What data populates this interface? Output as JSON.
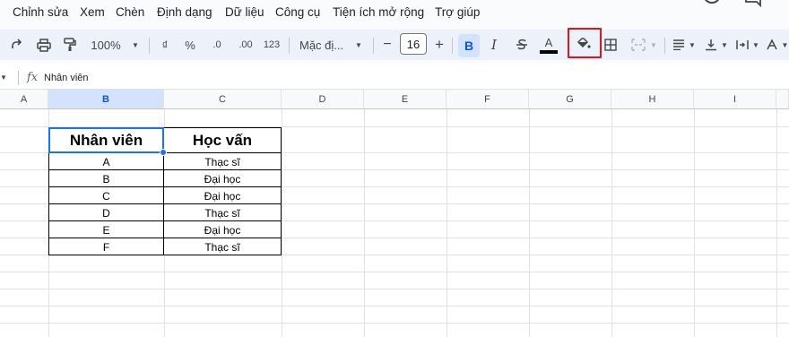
{
  "menu": {
    "items": [
      "Chỉnh sửa",
      "Xem",
      "Chèn",
      "Định dạng",
      "Dữ liệu",
      "Công cụ",
      "Tiện ích mở rộng",
      "Trợ giúp"
    ]
  },
  "toolbar": {
    "zoom": "100%",
    "currency_symbol": "₫",
    "percent_symbol": "%",
    "decrease_decimal": ".0",
    "increase_decimal": ".00",
    "more_formats": "123",
    "font_name": "Mặc đị...",
    "font_size": "16",
    "minus": "−",
    "plus": "+",
    "bold": "B",
    "italic": "I",
    "text_color_letter": "A",
    "highlighted_tool": "fill-color-icon"
  },
  "formula_bar": {
    "fx_label": "fx",
    "value": "Nhân viên"
  },
  "grid": {
    "columns": [
      "A",
      "B",
      "C",
      "D",
      "E",
      "F",
      "G",
      "H",
      "I"
    ],
    "selected_column": "B"
  },
  "table": {
    "headers": [
      "Nhân viên",
      "Học vấn"
    ],
    "rows": [
      [
        "A",
        "Thạc sĩ"
      ],
      [
        "B",
        "Đại học"
      ],
      [
        "C",
        "Đại học"
      ],
      [
        "D",
        "Thạc sĩ"
      ],
      [
        "E",
        "Đại học"
      ],
      [
        "F",
        "Thạc sĩ"
      ]
    ]
  },
  "colors": {
    "accent": "#1a73e8",
    "selected_header_bg": "#d3e3fd",
    "highlight_box": "#e0161b",
    "toolbar_bg": "#edf2fa"
  }
}
